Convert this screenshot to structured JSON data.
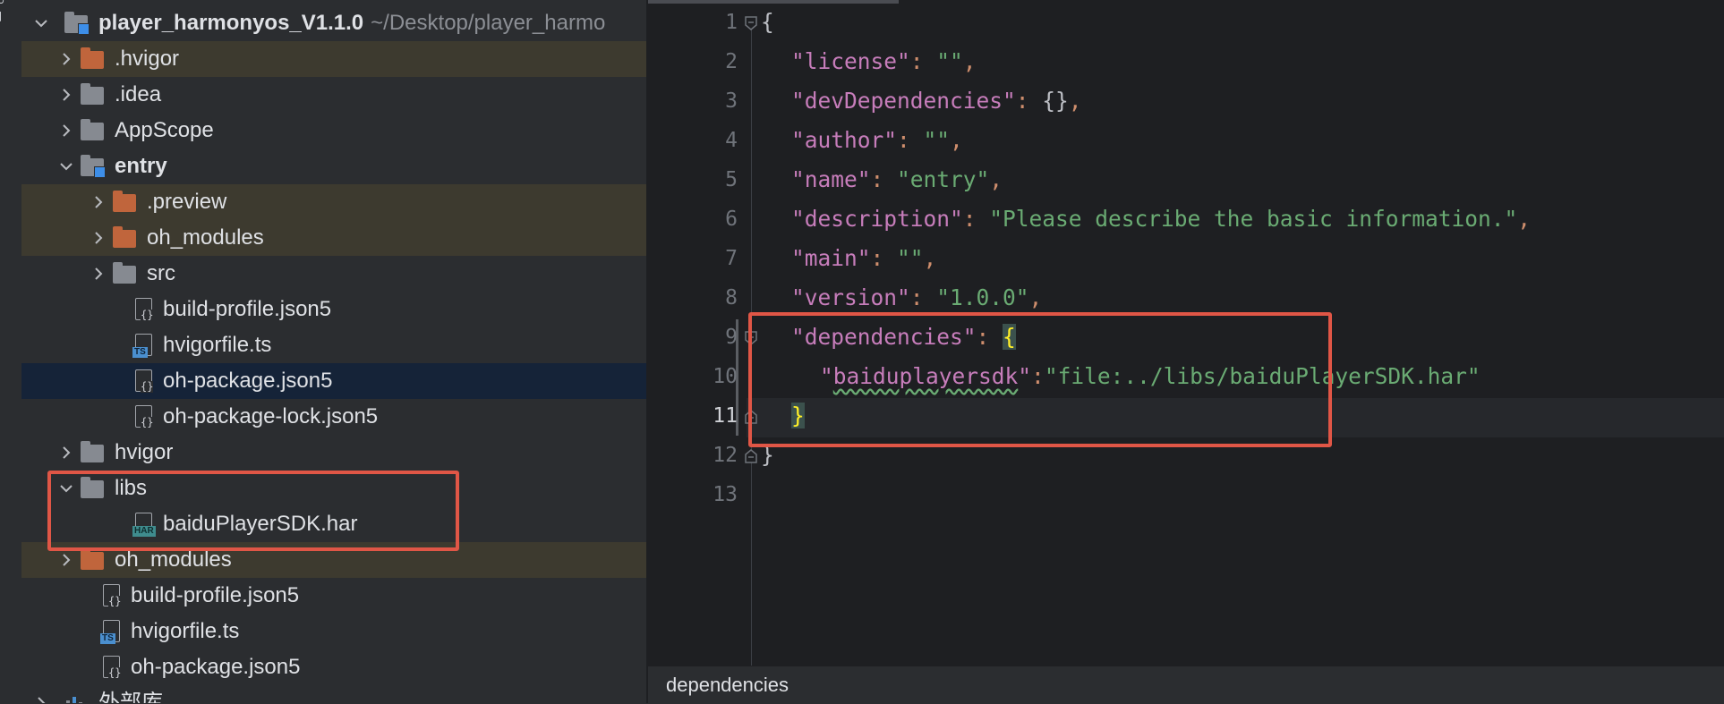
{
  "project_tree": {
    "root": {
      "name": "player_harmonyos_V1.1.0",
      "path": "~/Desktop/player_harmo"
    },
    "items": [
      {
        "name": ".hvigor",
        "kind": "folder-orange",
        "state": "collapsed"
      },
      {
        "name": ".idea",
        "kind": "folder",
        "state": "collapsed"
      },
      {
        "name": "AppScope",
        "kind": "folder",
        "state": "collapsed"
      },
      {
        "name": "entry",
        "kind": "module-folder",
        "state": "expanded"
      },
      {
        "name": ".preview",
        "kind": "folder-orange",
        "state": "collapsed"
      },
      {
        "name": "oh_modules",
        "kind": "folder-orange",
        "state": "collapsed"
      },
      {
        "name": "src",
        "kind": "folder",
        "state": "collapsed"
      },
      {
        "name": "build-profile.json5",
        "kind": "json-file"
      },
      {
        "name": "hvigorfile.ts",
        "kind": "ts-file"
      },
      {
        "name": "oh-package.json5",
        "kind": "json-file",
        "selected": true
      },
      {
        "name": "oh-package-lock.json5",
        "kind": "json-file"
      },
      {
        "name": "hvigor",
        "kind": "folder",
        "state": "collapsed"
      },
      {
        "name": "libs",
        "kind": "folder",
        "state": "expanded"
      },
      {
        "name": "baiduPlayerSDK.har",
        "kind": "har-file"
      },
      {
        "name": "oh_modules",
        "kind": "folder-orange",
        "state": "collapsed"
      },
      {
        "name": "build-profile.json5",
        "kind": "json-file"
      },
      {
        "name": "hvigorfile.ts",
        "kind": "ts-file"
      },
      {
        "name": "oh-package.json5",
        "kind": "json-file"
      },
      {
        "name": "外部库",
        "kind": "libraries"
      }
    ],
    "icon_badges": {
      "ts": "TS",
      "har": "HAR",
      "json": "{}"
    }
  },
  "editor": {
    "line_numbers": [
      "1",
      "2",
      "3",
      "4",
      "5",
      "6",
      "7",
      "8",
      "9",
      "10",
      "11",
      "12",
      "13"
    ],
    "current_line": "11",
    "lines": {
      "l1": "{",
      "l2_key": "\"license\"",
      "l2_val": "\"\"",
      "l3_key": "\"devDependencies\"",
      "l3_val": "{}",
      "l4_key": "\"author\"",
      "l4_val": "\"\"",
      "l5_key": "\"name\"",
      "l5_val": "\"entry\"",
      "l6_key": "\"description\"",
      "l6_val": "\"Please describe the basic information.\"",
      "l7_key": "\"main\"",
      "l7_val": "\"\"",
      "l8_key": "\"version\"",
      "l8_val": "\"1.0.0\"",
      "l9_key": "\"dependencies\"",
      "l9_brace": "{",
      "l10_key": "baiduplayersdk",
      "l10_val": "\"file:../libs/baiduPlayerSDK.har\"",
      "l11_brace": "}",
      "l12": "}"
    }
  },
  "breadcrumb": {
    "text": "dependencies"
  },
  "colors": {
    "highlight_box": "#e05646",
    "json_key": "#c77dbb",
    "json_string": "#6aab73",
    "punctuation": "#cf8e6d",
    "selected_row": "#152338",
    "excluded_row": "#3d3a2f"
  }
}
